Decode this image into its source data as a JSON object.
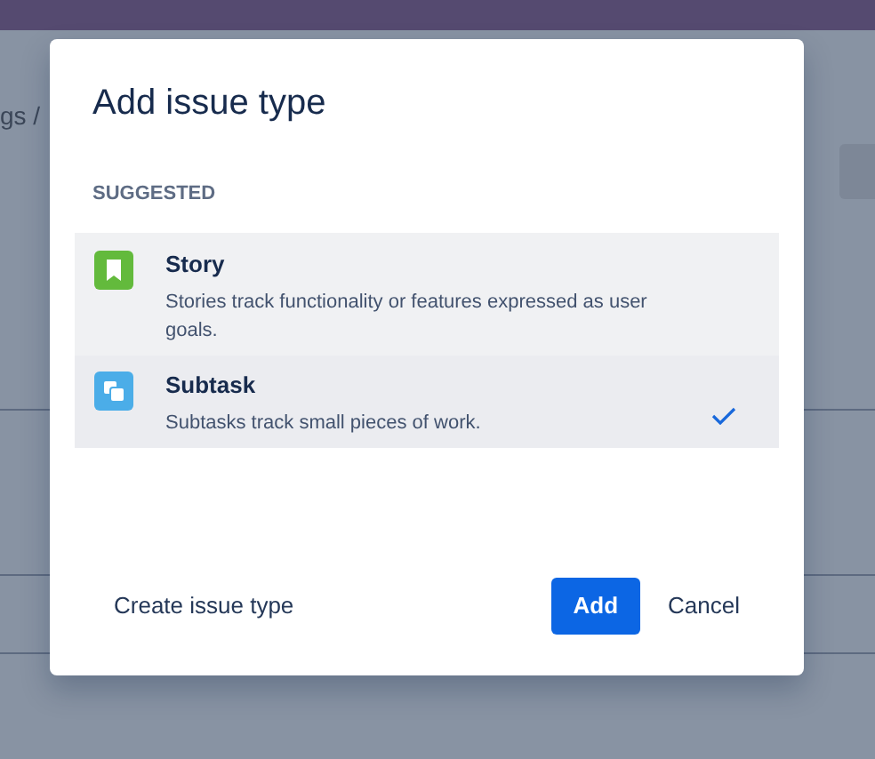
{
  "background": {
    "breadcrumb": "gs /"
  },
  "dialog": {
    "title": "Add issue type",
    "section_label": "SUGGESTED",
    "options": [
      {
        "kind": "story",
        "name": "Story",
        "description": "Stories track functionality or features expressed as user goals.",
        "selected": false
      },
      {
        "kind": "subtask",
        "name": "Subtask",
        "description": "Subtasks track small pieces of work.",
        "selected": true
      }
    ],
    "link": "Create issue type",
    "primary_button": "Add",
    "secondary_button": "Cancel"
  }
}
